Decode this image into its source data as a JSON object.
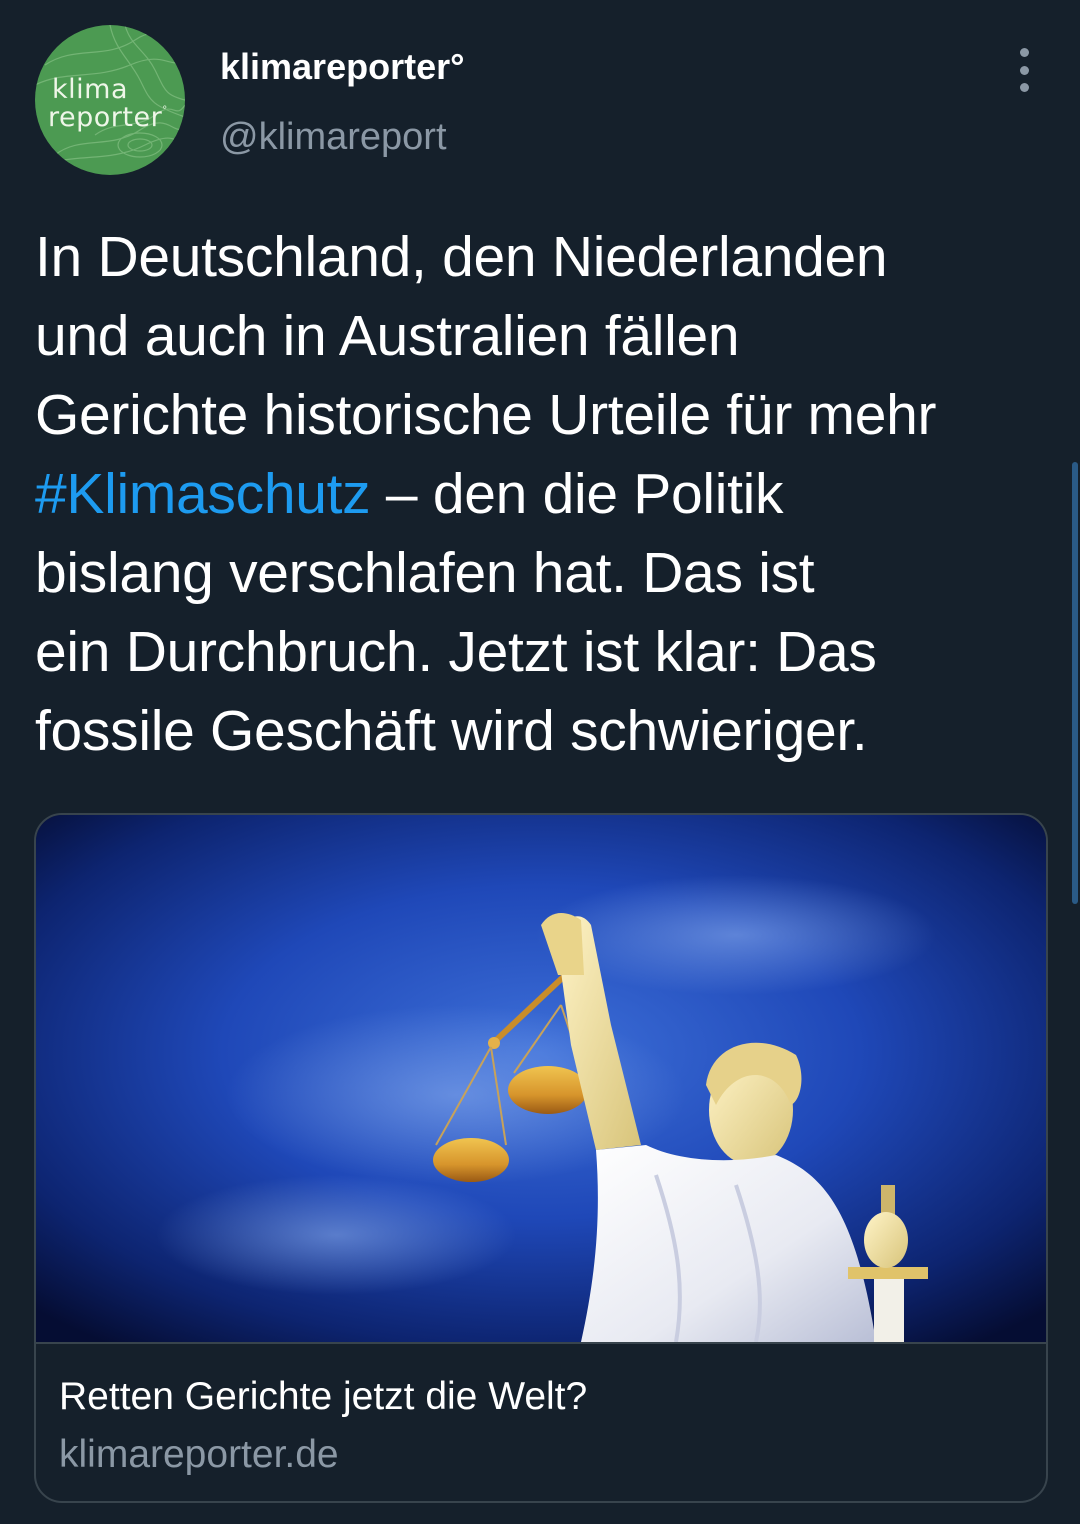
{
  "author": {
    "avatar_line1": "klima",
    "avatar_line2": "reporter",
    "avatar_mark": "°",
    "avatar_color": "#4c9a52",
    "display_name": "klimareporter°",
    "handle": "@klimareport"
  },
  "menu": {
    "icon": "more-vertical-icon"
  },
  "tweet": {
    "lines": [
      "In Deutschland, den Niederlanden",
      "und auch in Australien fällen",
      "Gerichte historische Urteile für mehr"
    ],
    "hashtag": "#Klimaschutz",
    "after_hashtag": " – den die Politik",
    "lines_after": [
      "bislang verschlafen hat. Das ist",
      "ein Durchbruch. Jetzt ist klar: Das",
      "fossile Geschäft wird schwieriger."
    ]
  },
  "link_card": {
    "image_description_icon": "lady-justice-statue-image",
    "title": "Retten Gerichte jetzt die Welt?",
    "domain": "klimareporter.de"
  },
  "colors": {
    "background": "#15202b",
    "text": "#ffffff",
    "secondary_text": "#8b98a5",
    "link": "#1d9bf0",
    "border": "#38444d"
  }
}
